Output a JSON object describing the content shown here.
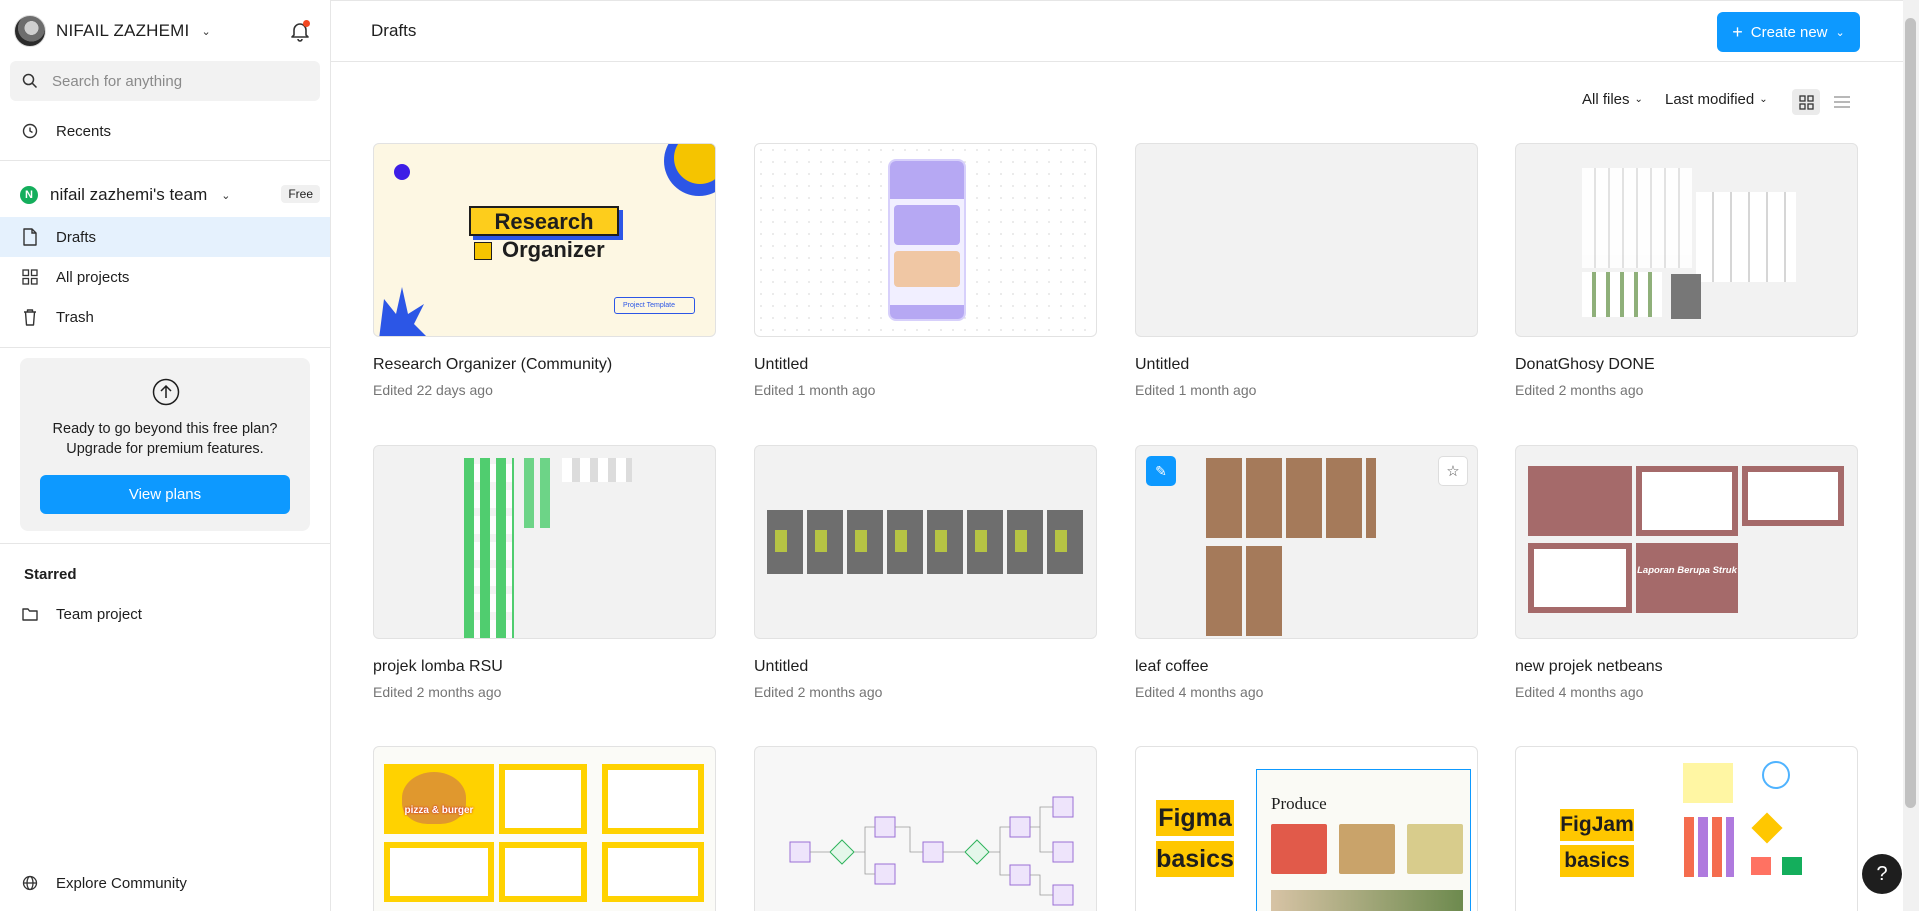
{
  "user": {
    "name": "NIFAIL ZAZHEMI"
  },
  "search": {
    "placeholder": "Search for anything"
  },
  "nav": {
    "recents": "Recents",
    "drafts": "Drafts",
    "all_projects": "All projects",
    "trash": "Trash"
  },
  "team": {
    "initial": "N",
    "name": "nifail zazhemi's team",
    "plan_badge": "Free"
  },
  "upgrade": {
    "line1": "Ready to go beyond this free plan?",
    "line2": "Upgrade for premium features.",
    "button": "View plans"
  },
  "starred": {
    "title": "Starred",
    "items": [
      {
        "label": "Team project"
      }
    ]
  },
  "explore": {
    "label": "Explore Community"
  },
  "header": {
    "title": "Drafts",
    "create_label": "Create new"
  },
  "filters": {
    "files": "All files",
    "sort": "Last modified"
  },
  "colors": {
    "accent": "#0d99ff",
    "active_nav": "#e5f1fd"
  },
  "files": [
    {
      "title": "Research Organizer (Community)",
      "edited": "Edited 22 days ago",
      "thumb_text_1": "Research",
      "thumb_text_2": "Organizer",
      "thumb_chip": "Project Template"
    },
    {
      "title": "Untitled",
      "edited": "Edited 1 month ago"
    },
    {
      "title": "Untitled",
      "edited": "Edited 1 month ago"
    },
    {
      "title": "DonatGhosy DONE",
      "edited": "Edited 2 months ago"
    },
    {
      "title": "projek lomba RSU",
      "edited": "Edited 2 months ago"
    },
    {
      "title": "Untitled",
      "edited": "Edited 2 months ago"
    },
    {
      "title": "leaf coffee",
      "edited": "Edited 4 months ago"
    },
    {
      "title": "new projek netbeans",
      "edited": "Edited 4 months ago",
      "thumb_text": "Laporan Berupa Struk"
    },
    {
      "title": "",
      "edited": "",
      "thumb_text": "pizza & burger"
    },
    {
      "title": "",
      "edited": ""
    },
    {
      "title": "",
      "edited": "",
      "thumb_text_1": "Figma",
      "thumb_text_2": "basics",
      "thumb_text_3": "Produce"
    },
    {
      "title": "",
      "edited": "",
      "thumb_text_1": "FigJam",
      "thumb_text_2": "basics"
    }
  ]
}
